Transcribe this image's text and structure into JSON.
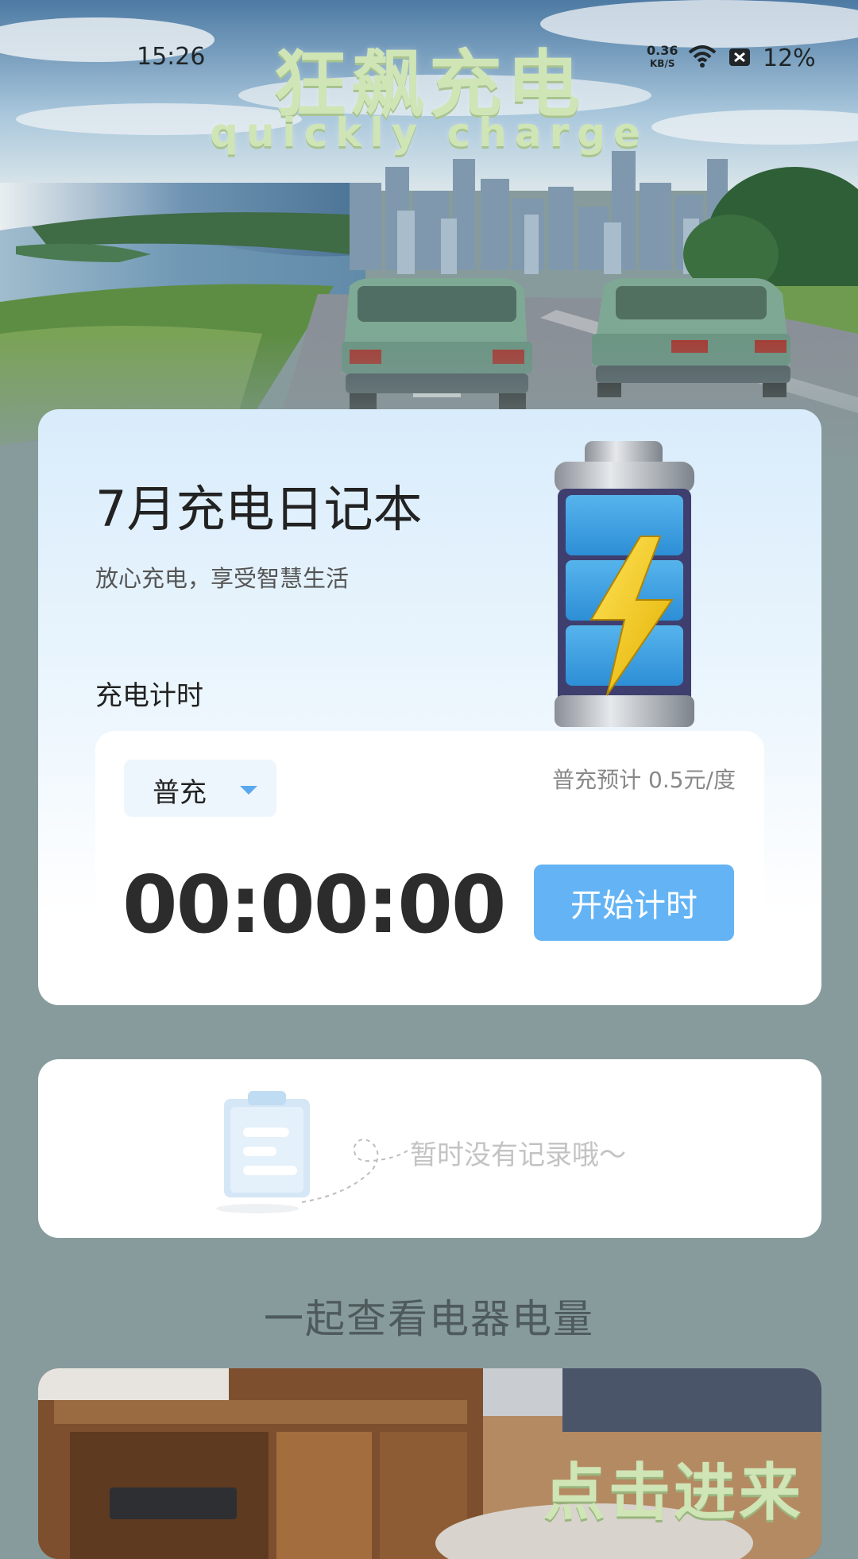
{
  "status_bar": {
    "time": "15:26",
    "net_speed_value": "0.36",
    "net_speed_unit": "KB/S",
    "battery": "12%"
  },
  "header": {
    "title_cn": "狂飙充电",
    "title_en": "quickly charge"
  },
  "diary_card": {
    "title": "7月充电日记本",
    "subtitle": "放心充电，享受智慧生活",
    "section_label": "充电计时",
    "mode_selected": "普充",
    "price_note": "普充预计 0.5元/度",
    "timer": "00:00:00",
    "start_button": "开始计时"
  },
  "records_card": {
    "empty_text": "暂时没有记录哦～"
  },
  "appliance_section": {
    "heading": "一起查看电器电量",
    "enter_label": "点击进来"
  },
  "colors": {
    "page_bg": "#879b9c",
    "accent_blue": "#64b4f5",
    "title_green": "#cfe5b6"
  },
  "icons": [
    "wifi-icon",
    "battery-status-icon",
    "chevron-down-icon",
    "battery-illustration",
    "clipboard-icon"
  ]
}
